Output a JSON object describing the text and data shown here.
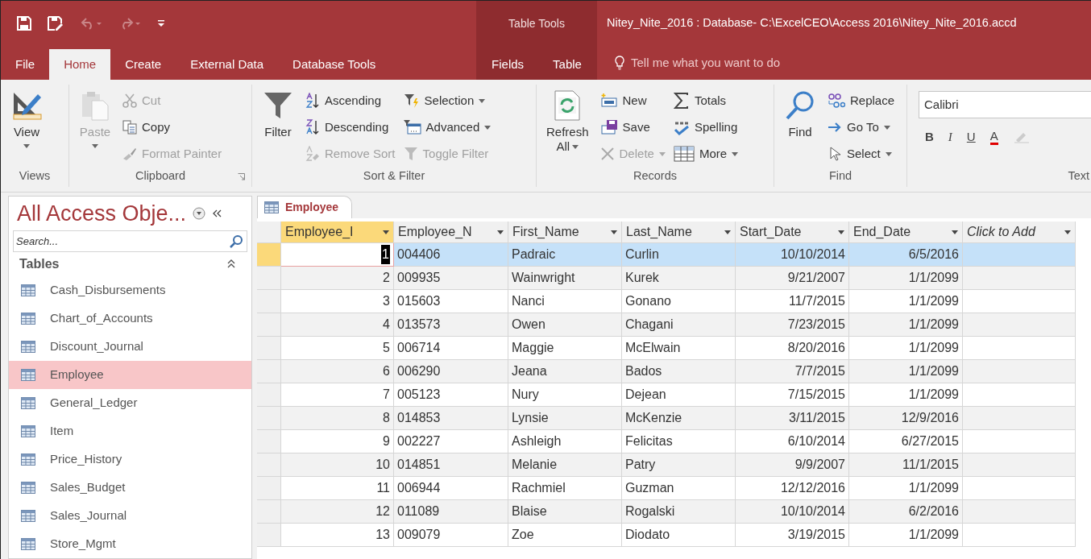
{
  "title_bar": {
    "context_label": "Table Tools",
    "title": "Nitey_Nite_2016 : Database- C:\\ExcelCEO\\Access 2016\\Nitey_Nite_2016.accd"
  },
  "tabs": [
    {
      "label": "File",
      "selected": false,
      "contextual": false
    },
    {
      "label": "Home",
      "selected": true,
      "contextual": false
    },
    {
      "label": "Create",
      "selected": false,
      "contextual": false
    },
    {
      "label": "External Data",
      "selected": false,
      "contextual": false
    },
    {
      "label": "Database Tools",
      "selected": false,
      "contextual": false
    },
    {
      "label": "Fields",
      "selected": false,
      "contextual": true
    },
    {
      "label": "Table",
      "selected": false,
      "contextual": true
    }
  ],
  "tell_me": {
    "placeholder": "Tell me what you want to do"
  },
  "ribbon": {
    "groups": [
      {
        "label": "Views",
        "launcher": false,
        "large": [
          {
            "lines": [
              "View"
            ],
            "disabled": false,
            "dropdown": true
          }
        ]
      },
      {
        "label": "Clipboard",
        "launcher": true,
        "large": [
          {
            "lines": [
              "Paste"
            ],
            "disabled": true,
            "dropdown": true
          }
        ],
        "columns": [
          [
            {
              "label": "Cut",
              "disabled": true,
              "dropdown": false
            },
            {
              "label": "Copy",
              "disabled": false,
              "dropdown": false
            },
            {
              "label": "Format Painter",
              "disabled": true,
              "dropdown": false
            }
          ]
        ]
      },
      {
        "label": "Sort & Filter",
        "launcher": false,
        "large": [
          {
            "lines": [
              "Filter"
            ],
            "disabled": false,
            "dropdown": false
          }
        ],
        "columns": [
          [
            {
              "label": "Ascending",
              "disabled": false,
              "dropdown": false
            },
            {
              "label": "Descending",
              "disabled": false,
              "dropdown": false
            },
            {
              "label": "Remove Sort",
              "disabled": true,
              "dropdown": false
            }
          ],
          [
            {
              "label": "Selection",
              "disabled": false,
              "dropdown": true
            },
            {
              "label": "Advanced",
              "disabled": false,
              "dropdown": true
            },
            {
              "label": "Toggle Filter",
              "disabled": true,
              "dropdown": false
            }
          ]
        ]
      },
      {
        "label": "Records",
        "launcher": false,
        "large": [
          {
            "lines": [
              "Refresh",
              "All"
            ],
            "disabled": false,
            "dropdown": true
          }
        ],
        "columns": [
          [
            {
              "label": "New",
              "disabled": false,
              "dropdown": false
            },
            {
              "label": "Save",
              "disabled": false,
              "dropdown": false
            },
            {
              "label": "Delete",
              "disabled": true,
              "dropdown": true
            }
          ],
          [
            {
              "label": "Totals",
              "disabled": false,
              "dropdown": false
            },
            {
              "label": "Spelling",
              "disabled": false,
              "dropdown": false
            },
            {
              "label": "More",
              "disabled": false,
              "dropdown": true
            }
          ]
        ]
      },
      {
        "label": "Find",
        "launcher": false,
        "large": [
          {
            "lines": [
              "Find"
            ],
            "disabled": false,
            "dropdown": false
          }
        ],
        "columns": [
          [
            {
              "label": "Replace",
              "disabled": false,
              "dropdown": false
            },
            {
              "label": "Go To",
              "disabled": false,
              "dropdown": true
            },
            {
              "label": "Select",
              "disabled": false,
              "dropdown": true
            }
          ]
        ]
      }
    ],
    "text_group": {
      "label": "Text",
      "font": "Calibri",
      "buttons": [
        "B",
        "I",
        "U",
        "A"
      ]
    }
  },
  "nav_pane": {
    "title": "All Access Obje...",
    "search": {
      "placeholder": "Search..."
    },
    "section": "Tables",
    "items": [
      {
        "label": "Cash_Disbursements",
        "selected": false
      },
      {
        "label": "Chart_of_Accounts",
        "selected": false
      },
      {
        "label": "Discount_Journal",
        "selected": false
      },
      {
        "label": "Employee",
        "selected": true
      },
      {
        "label": "General_Ledger",
        "selected": false
      },
      {
        "label": "Item",
        "selected": false
      },
      {
        "label": "Price_History",
        "selected": false
      },
      {
        "label": "Sales_Budget",
        "selected": false
      },
      {
        "label": "Sales_Journal",
        "selected": false
      },
      {
        "label": "Store_Mgmt",
        "selected": false
      }
    ]
  },
  "datasheet": {
    "tab": "Employee",
    "columns": [
      {
        "label": "Employee_I",
        "kind": "number",
        "selected": true
      },
      {
        "label": "Employee_N",
        "kind": "text",
        "selected": false
      },
      {
        "label": "First_Name",
        "kind": "text",
        "selected": false
      },
      {
        "label": "Last_Name",
        "kind": "text",
        "selected": false
      },
      {
        "label": "Start_Date",
        "kind": "date",
        "selected": false
      },
      {
        "label": "End_Date",
        "kind": "date",
        "selected": false
      },
      {
        "label": "Click to Add",
        "kind": "add",
        "selected": false
      }
    ],
    "rows": [
      {
        "selected": true,
        "cells": [
          "1",
          "004406",
          "Padraic",
          "Curlin",
          "10/10/2014",
          "6/5/2016"
        ]
      },
      {
        "selected": false,
        "cells": [
          "2",
          "009935",
          "Wainwright",
          "Kurek",
          "9/21/2007",
          "1/1/2099"
        ]
      },
      {
        "selected": false,
        "cells": [
          "3",
          "015603",
          "Nanci",
          "Gonano",
          "11/7/2015",
          "1/1/2099"
        ]
      },
      {
        "selected": false,
        "cells": [
          "4",
          "013573",
          "Owen",
          "Chagani",
          "7/23/2015",
          "1/1/2099"
        ]
      },
      {
        "selected": false,
        "cells": [
          "5",
          "006714",
          "Maggie",
          "McElwain",
          "8/20/2016",
          "1/1/2099"
        ]
      },
      {
        "selected": false,
        "cells": [
          "6",
          "006290",
          "Jeana",
          "Bados",
          "7/7/2015",
          "1/1/2099"
        ]
      },
      {
        "selected": false,
        "cells": [
          "7",
          "005123",
          "Nury",
          "Dejean",
          "7/15/2015",
          "1/1/2099"
        ]
      },
      {
        "selected": false,
        "cells": [
          "8",
          "014853",
          "Lynsie",
          "McKenzie",
          "3/11/2015",
          "12/9/2016"
        ]
      },
      {
        "selected": false,
        "cells": [
          "9",
          "002227",
          "Ashleigh",
          "Felicitas",
          "6/10/2014",
          "6/27/2015"
        ]
      },
      {
        "selected": false,
        "cells": [
          "10",
          "014851",
          "Melanie",
          "Patry",
          "9/9/2007",
          "11/1/2015"
        ]
      },
      {
        "selected": false,
        "cells": [
          "11",
          "006944",
          "Rachmiel",
          "Guzman",
          "12/12/2016",
          "1/1/2099"
        ]
      },
      {
        "selected": false,
        "cells": [
          "12",
          "011089",
          "Blaise",
          "Rogalski",
          "10/10/2014",
          "6/2/2016"
        ]
      },
      {
        "selected": false,
        "cells": [
          "13",
          "009079",
          "Zoe",
          "Diodato",
          "3/19/2015",
          "1/1/2099"
        ]
      }
    ]
  }
}
